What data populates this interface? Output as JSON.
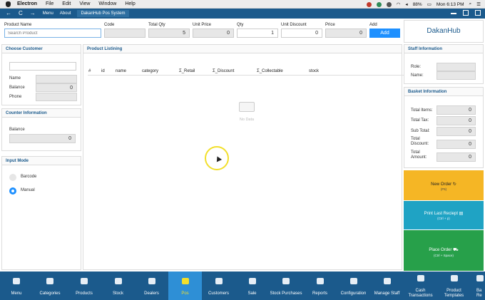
{
  "mac_menubar": {
    "app": "Electron",
    "menus": [
      "File",
      "Edit",
      "View",
      "Window",
      "Help"
    ],
    "battery": "88%",
    "clock": "Mon 6:13 PM"
  },
  "app_toolbar": {
    "back": "←",
    "refresh": "C",
    "forward": "→",
    "menu_label": "Menu",
    "about_label": "About",
    "title": "DakanHub Pos System"
  },
  "fields": {
    "product_name": {
      "label": "Product Name",
      "placeholder": "Search Product"
    },
    "code": {
      "label": "Code",
      "value": ""
    },
    "total_qty": {
      "label": "Total Qty",
      "value": "5"
    },
    "unit_price": {
      "label": "Unit Price",
      "value": "0"
    },
    "qty": {
      "label": "Qty",
      "value": "1"
    },
    "unit_discount": {
      "label": "Unit Discount",
      "value": "0"
    },
    "price": {
      "label": "Price",
      "value": "0"
    },
    "add": {
      "label": "Add",
      "button": "Add"
    }
  },
  "brand": "DakanHub",
  "choose_customer": {
    "title": "Choose Customer",
    "search_value": "",
    "name_label": "Name",
    "name_value": "",
    "balance_label": "Balance",
    "balance_value": "0",
    "phone_label": "Phone",
    "phone_value": ""
  },
  "counter_info": {
    "title": "Counter Information",
    "balance_label": "Balance",
    "balance_value": "0"
  },
  "input_mode": {
    "title": "Input Mode",
    "options": [
      {
        "label": "Barcode",
        "selected": false
      },
      {
        "label": "Manual",
        "selected": true
      }
    ]
  },
  "product_listing": {
    "title": "Product Listining",
    "columns": [
      "#",
      "id",
      "name",
      "category",
      "Σ_Retail",
      "Σ_Discount",
      "Σ_Collectable",
      "stock"
    ],
    "empty_text": "No Data"
  },
  "staff_info": {
    "title": "Staff Information",
    "role_label": "Role:",
    "role_value": "",
    "name_label": "Name:",
    "name_value": ""
  },
  "basket_info": {
    "title": "Basket Information",
    "rows": [
      {
        "label": "Total Items:",
        "value": "0"
      },
      {
        "label": "Total Tax:",
        "value": "0"
      },
      {
        "label": "Sub Total:",
        "value": "0"
      },
      {
        "label": "Total Discount:",
        "value": "0"
      },
      {
        "label": "Total Amount:",
        "value": "0"
      }
    ]
  },
  "actions": {
    "new_order": {
      "label": "New Order",
      "shortcut": "(F5)",
      "color": "#f5b625"
    },
    "print_last": {
      "label": "Print Last Reciept",
      "shortcut": "(Ctrl + p)",
      "color": "#1fa3c4"
    },
    "place_order": {
      "label": "Place Order",
      "shortcut": "(Ctrl + Space)",
      "color": "#27a04a"
    }
  },
  "bottom_nav": [
    {
      "label": "Menu",
      "icon": "home-icon"
    },
    {
      "label": "Categories",
      "icon": "sitemap-icon"
    },
    {
      "label": "Products",
      "icon": "briefcase-icon"
    },
    {
      "label": "Stock",
      "icon": "cubes-icon"
    },
    {
      "label": "Dealers",
      "icon": "users-icon"
    },
    {
      "label": "Pos",
      "icon": "monitor-icon",
      "active": true
    },
    {
      "label": "Customers",
      "icon": "group-icon"
    },
    {
      "label": "Sale",
      "icon": "cart-icon"
    },
    {
      "label": "Stock Purchases",
      "icon": "file-icon"
    },
    {
      "label": "Reports",
      "icon": "chart-icon"
    },
    {
      "label": "Configuration",
      "icon": "cogs-icon"
    },
    {
      "label": "Manage Staff",
      "icon": "user-icon"
    },
    {
      "label": "Cash Transactions",
      "icon": "money-icon"
    },
    {
      "label": "Product Templates",
      "icon": "layers-icon"
    },
    {
      "label": "Ba Re",
      "icon": "box-icon"
    }
  ],
  "colors": {
    "toolbar": "#1b5a8c",
    "accent": "#1e90ff",
    "active_nav": "#2e8fd6",
    "highlight": "#f2df2b"
  }
}
